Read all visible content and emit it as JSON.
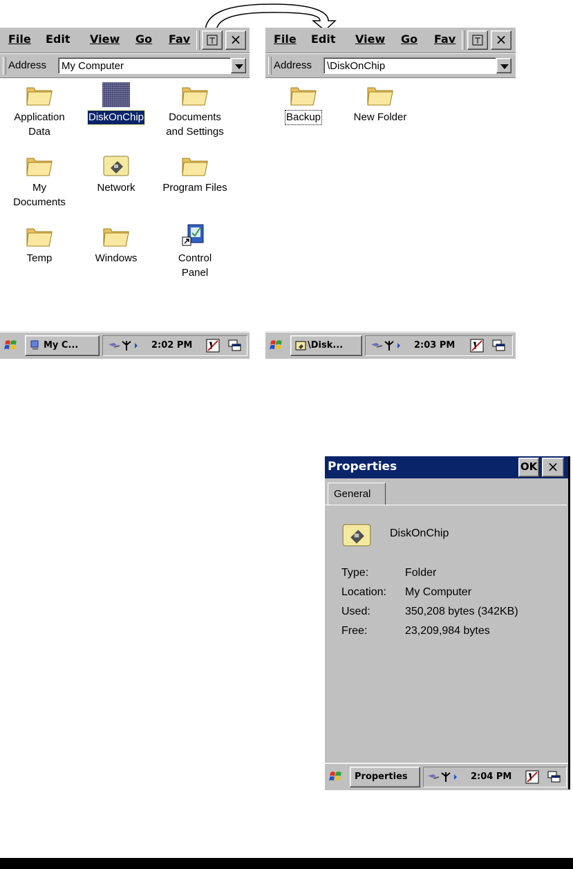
{
  "menu": {
    "file": "File",
    "edit": "Edit",
    "view": "View",
    "go": "Go",
    "fav": "Fav"
  },
  "close_glyph": "×",
  "address_label": "Address",
  "screen1": {
    "address_value": "My Computer",
    "icons": [
      {
        "line1": "Application",
        "line2": "Data",
        "icon": "folder-icon"
      },
      {
        "line1": "DiskOnChip",
        "line2": "",
        "icon": "storage-card-icon"
      },
      {
        "line1": "Documents",
        "line2": "and Settings",
        "icon": "folder-icon"
      },
      {
        "line1": "My",
        "line2": "Documents",
        "icon": "folder-icon"
      },
      {
        "line1": "Network",
        "line2": "",
        "icon": "network-folder-icon"
      },
      {
        "line1": "Program Files",
        "line2": "",
        "icon": "folder-icon"
      },
      {
        "line1": "Temp",
        "line2": "",
        "icon": "folder-icon"
      },
      {
        "line1": "Windows",
        "line2": "",
        "icon": "folder-icon"
      },
      {
        "line1": "Control",
        "line2": "Panel",
        "icon": "control-panel-icon"
      }
    ],
    "task_label": "My C...",
    "clock": "2:02 PM"
  },
  "screen2": {
    "address_value": "\\DiskOnChip",
    "icons": [
      {
        "line1": "Backup",
        "icon": "folder-icon"
      },
      {
        "line1": "New Folder",
        "icon": "folder-icon"
      }
    ],
    "task_label": "\\Disk...",
    "clock": "2:03 PM"
  },
  "properties": {
    "title": "Properties",
    "ok_label": "OK",
    "tab_general": "General",
    "name": "DiskOnChip",
    "type_label": "Type:",
    "type_value": "Folder",
    "location_label": "Location:",
    "location_value": "My Computer",
    "used_label": "Used:",
    "used_value": "350,208 bytes (342KB)",
    "free_label": "Free:",
    "free_value": "23,209,984 bytes",
    "task_label": "Properties",
    "clock": "2:04 PM"
  },
  "colors": {
    "chrome": "#c0c0c0",
    "selection": "#0a246a",
    "folder": "#f8e08a"
  }
}
